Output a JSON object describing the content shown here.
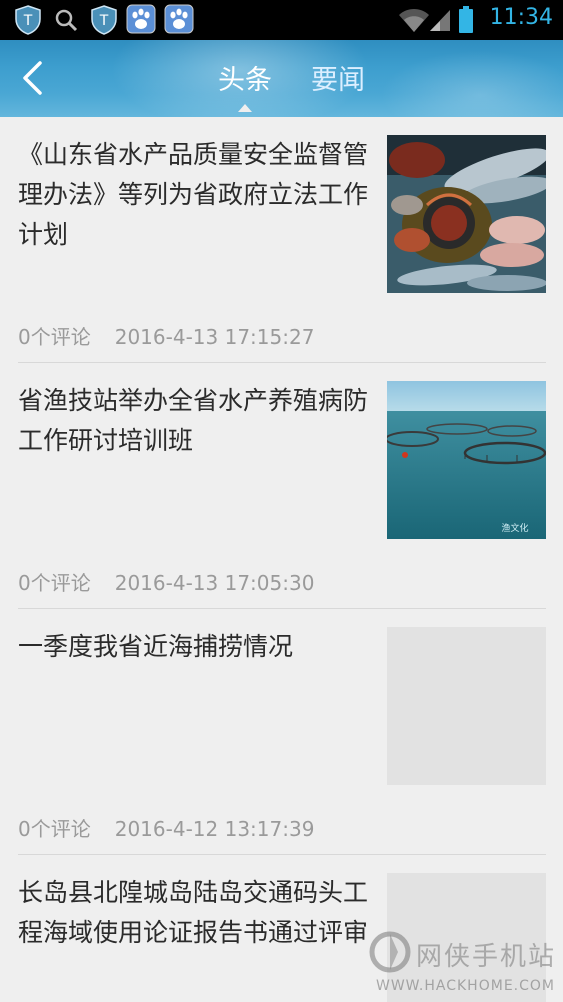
{
  "status_bar": {
    "time": "11:34",
    "icons": [
      "shield-icon",
      "search-icon",
      "shield-icon",
      "baidu-paw-icon",
      "baidu-paw-icon",
      "wifi-icon",
      "signal-icon",
      "battery-icon"
    ]
  },
  "header": {
    "tabs": [
      {
        "label": "头条",
        "active": true
      },
      {
        "label": "要闻",
        "active": false
      }
    ]
  },
  "news": [
    {
      "title": "《山东省水产品质量安全监督管理办法》等列为省政府立法工作计划",
      "comments": "0个评论",
      "time": "2016-4-13 17:15:27",
      "thumbnail": "seafood-photo"
    },
    {
      "title": "省渔技站举办全省水产养殖病防工作研讨培训班",
      "comments": "0个评论",
      "time": "2016-4-13 17:05:30",
      "thumbnail": "fish-farm-photo"
    },
    {
      "title": "一季度我省近海捕捞情况",
      "comments": "0个评论",
      "time": "2016-4-12 13:17:39",
      "thumbnail": "placeholder"
    },
    {
      "title": "长岛县北隍城岛陆岛交通码头工程海域使用论证报告书通过评审",
      "comments": "",
      "time": "",
      "thumbnail": "placeholder"
    }
  ],
  "watermark": {
    "text": "网侠手机站",
    "url": "WWW.HACKHOME.COM"
  },
  "colors": {
    "accent": "#33b5e5",
    "header_blue": "#3d9ece",
    "background": "#efefef",
    "title_text": "#2b2b2b",
    "meta_text": "#9a9a9a"
  }
}
